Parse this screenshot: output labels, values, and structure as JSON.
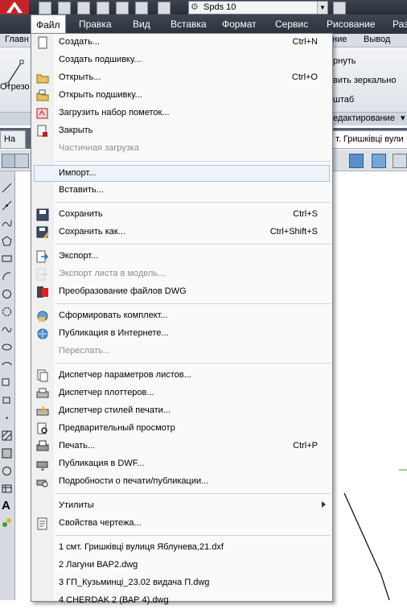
{
  "titlebar": {
    "workspace": "Spds 10"
  },
  "menubar": {
    "items": [
      "Файл",
      "Правка",
      "Вид",
      "Вставка",
      "Формат",
      "Сервис",
      "Рисование",
      "Раз"
    ]
  },
  "ribbon": {
    "tabs": [
      "Главн",
      "ние",
      "Вывод"
    ],
    "tools": [
      "Отрезо",
      "рнуть",
      "вить зеркально",
      "штаб"
    ],
    "panel_label": "едактирование"
  },
  "doc_tabs": [
    "На",
    "т. Гришківці вули"
  ],
  "file_menu": {
    "items": [
      {
        "label": "Создать...",
        "shortcut": "Ctrl+N",
        "icon": "new-file-icon"
      },
      {
        "label": "Создать подшивку...",
        "shortcut": ""
      },
      {
        "label": "Открыть...",
        "shortcut": "Ctrl+O",
        "icon": "open-folder-icon"
      },
      {
        "label": "Открыть подшивку...",
        "shortcut": "",
        "icon": "open-sheetset-icon"
      },
      {
        "label": "Загрузить набор пометок...",
        "shortcut": "",
        "icon": "markup-icon"
      },
      {
        "label": "Закрыть",
        "shortcut": "",
        "icon": "close-file-icon"
      },
      {
        "label": "Частичная загрузка",
        "shortcut": "",
        "disabled": true
      },
      {
        "label": "Импорт...",
        "shortcut": ""
      },
      {
        "label": "Вставить...",
        "shortcut": ""
      },
      {
        "label": "Сохранить",
        "shortcut": "Ctrl+S",
        "icon": "save-icon"
      },
      {
        "label": "Сохранить как...",
        "shortcut": "Ctrl+Shift+S",
        "icon": "save-as-icon"
      },
      {
        "label": "Экспорт...",
        "shortcut": "",
        "icon": "export-icon"
      },
      {
        "label": "Экспорт листа в модель...",
        "shortcut": "",
        "disabled": true,
        "icon": "export-layout-icon"
      },
      {
        "label": "Преобразование файлов DWG",
        "shortcut": "",
        "icon": "dwg-convert-icon"
      },
      {
        "label": "Сформировать комплект...",
        "shortcut": "",
        "icon": "etransmit-icon"
      },
      {
        "label": "Публикация в Интернете...",
        "shortcut": "",
        "icon": "publish-web-icon"
      },
      {
        "label": "Переслать...",
        "shortcut": "",
        "disabled": true
      },
      {
        "label": "Диспетчер параметров листов...",
        "shortcut": "",
        "icon": "page-setup-icon"
      },
      {
        "label": "Диспетчер плоттеров...",
        "shortcut": "",
        "icon": "plotter-manager-icon"
      },
      {
        "label": "Диспетчер стилей печати...",
        "shortcut": "",
        "icon": "plot-style-icon"
      },
      {
        "label": "Предварительный просмотр",
        "shortcut": "",
        "icon": "preview-icon"
      },
      {
        "label": "Печать...",
        "shortcut": "Ctrl+P",
        "icon": "print-icon"
      },
      {
        "label": "Публикация в DWF...",
        "shortcut": "",
        "icon": "publish-dwf-icon"
      },
      {
        "label": "Подробности о печати/публикации...",
        "shortcut": "",
        "icon": "plot-details-icon"
      },
      {
        "label": "Утилиты",
        "shortcut": ""
      },
      {
        "label": "Свойства чертежа...",
        "shortcut": "",
        "icon": "drawing-properties-icon"
      },
      {
        "label": "1 смт. Гришківці вулиця Яблунева,21.dxf",
        "shortcut": ""
      },
      {
        "label": "2 Лагуни ВАР2.dwg",
        "shortcut": ""
      },
      {
        "label": "3 ГП_Кузьминці_23.02 видача П.dwg",
        "shortcut": ""
      },
      {
        "label": "4 CHERDAK 2 (ВАР 4).dwg",
        "shortcut": ""
      }
    ]
  },
  "colors": {
    "menubar": "#2d333c",
    "accent_red": "#c4232a",
    "highlight_border": "#a9c1e0"
  }
}
